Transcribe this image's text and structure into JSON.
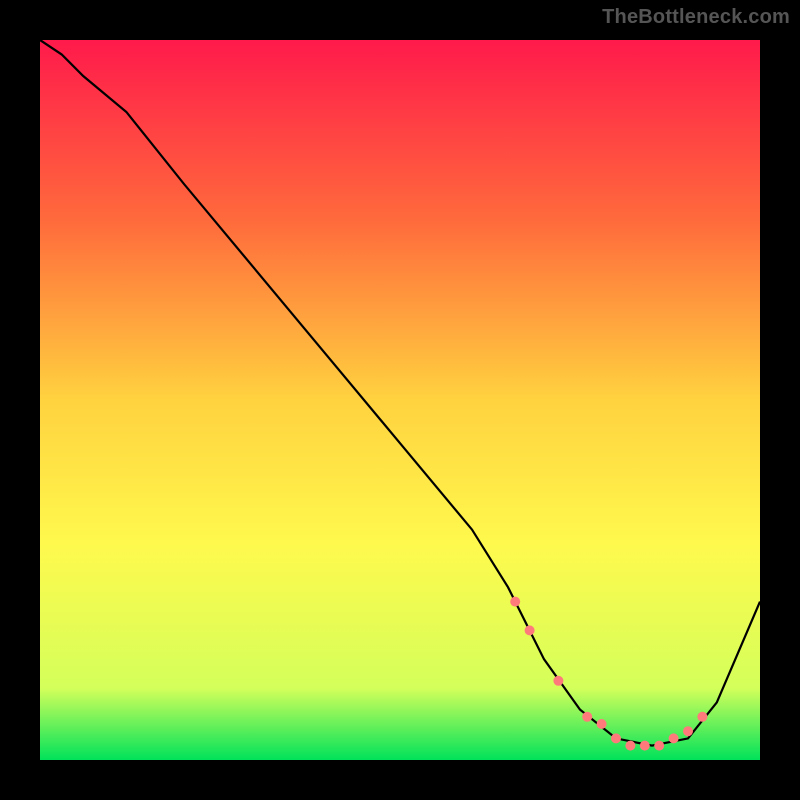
{
  "watermark": "TheBottleneck.com",
  "chart_data": {
    "type": "line",
    "title": "",
    "xlabel": "",
    "ylabel": "",
    "xlim": [
      0,
      100
    ],
    "ylim": [
      0,
      100
    ],
    "grid": false,
    "legend": false,
    "gradient_stops": [
      {
        "offset": 0,
        "color": "#ff1a4b"
      },
      {
        "offset": 25,
        "color": "#ff6a3c"
      },
      {
        "offset": 50,
        "color": "#ffd23f"
      },
      {
        "offset": 70,
        "color": "#fff94d"
      },
      {
        "offset": 90,
        "color": "#d4ff5a"
      },
      {
        "offset": 100,
        "color": "#00e25a"
      }
    ],
    "series": [
      {
        "name": "bottleneck-curve",
        "color": "#000000",
        "x": [
          0,
          3,
          6,
          12,
          20,
          30,
          40,
          50,
          60,
          65,
          70,
          75,
          80,
          85,
          90,
          94,
          100
        ],
        "values": [
          100,
          98,
          95,
          90,
          80,
          68,
          56,
          44,
          32,
          24,
          14,
          7,
          3,
          2,
          3,
          8,
          22
        ]
      }
    ],
    "markers": {
      "name": "highlight-points",
      "color": "#ff7b7b",
      "radius": 5,
      "x": [
        66,
        68,
        72,
        76,
        78,
        80,
        82,
        84,
        86,
        88,
        90,
        92
      ],
      "values": [
        22,
        18,
        11,
        6,
        5,
        3,
        2,
        2,
        2,
        3,
        4,
        6
      ]
    }
  }
}
